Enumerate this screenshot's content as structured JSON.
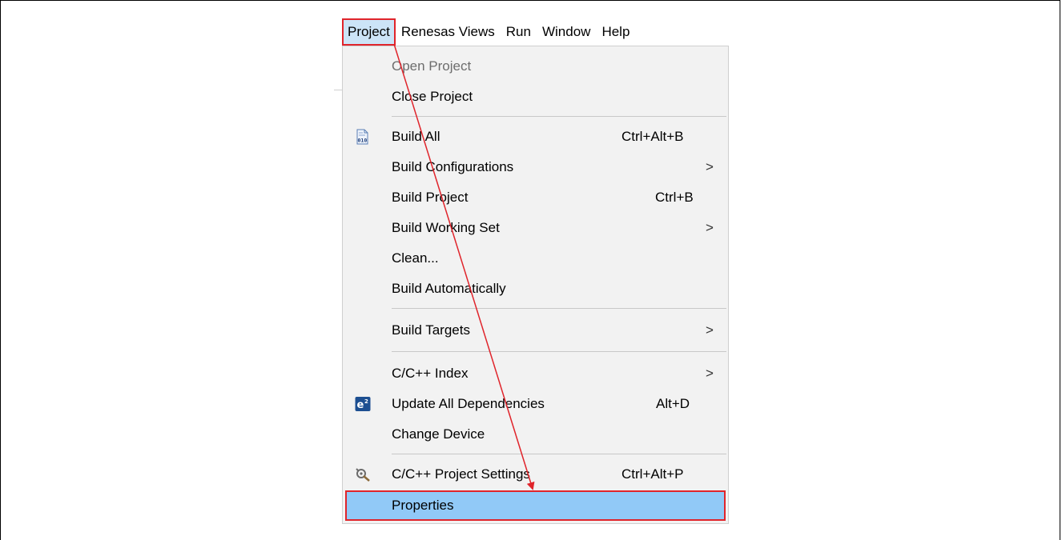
{
  "menubar": {
    "items": [
      {
        "label": "Project"
      },
      {
        "label": "Renesas Views"
      },
      {
        "label": "Run"
      },
      {
        "label": "Window"
      },
      {
        "label": "Help"
      }
    ]
  },
  "menu": {
    "open_project": "Open Project",
    "close_project": "Close Project",
    "build_all": {
      "label": "Build All",
      "shortcut": "Ctrl+Alt+B"
    },
    "build_configurations": {
      "label": "Build Configurations",
      "arrow": ">"
    },
    "build_project": {
      "label": "Build Project",
      "shortcut": "Ctrl+B"
    },
    "build_working_set": {
      "label": "Build Working Set",
      "arrow": ">"
    },
    "clean": "Clean...",
    "build_automatically": "Build Automatically",
    "build_targets": {
      "label": "Build Targets",
      "arrow": ">"
    },
    "cpp_index": {
      "label": "C/C++ Index",
      "arrow": ">"
    },
    "update_all_dependencies": {
      "label": "Update All Dependencies",
      "shortcut": "Alt+D"
    },
    "change_device": "Change Device",
    "cpp_project_settings": {
      "label": "C/C++ Project Settings",
      "shortcut": "Ctrl+Alt+P"
    },
    "properties": "Properties"
  },
  "icons": {
    "build_all": "binary-file-icon",
    "update_all_dependencies": "e2-studio-icon",
    "cpp_project_settings": "tools-icon"
  },
  "colors": {
    "highlight_selected": "#91c9f7",
    "highlight_menubar": "#cce4f7",
    "annotation_red": "#e0242b",
    "menu_bg": "#f2f2f2"
  }
}
